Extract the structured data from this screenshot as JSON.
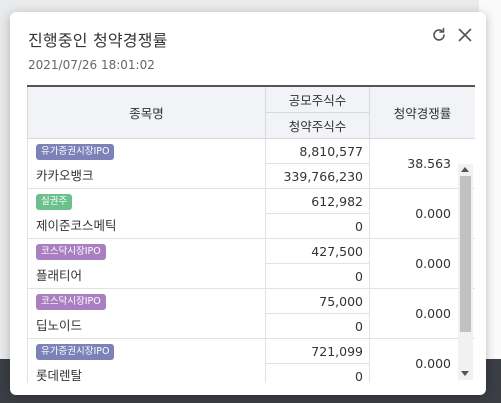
{
  "popup": {
    "title": "진행중인 청약경쟁률",
    "timestamp": "2021/07/26 18:01:02",
    "refresh_icon": "refresh-icon",
    "close_icon": "close-icon"
  },
  "table": {
    "headers": {
      "name": "종목명",
      "offer_shares": "공모주식수",
      "subscribed_shares": "청약주식수",
      "rate": "청약경쟁률"
    },
    "rows": [
      {
        "badge": "유가증권시장IPO",
        "badge_color": "#7b82b8",
        "name": "카카오뱅크",
        "offer": "8,810,577",
        "subscribed": "339,766,230",
        "rate": "38.563"
      },
      {
        "badge": "실권주",
        "badge_color": "#6cc08b",
        "name": "제이준코스메틱",
        "offer": "612,982",
        "subscribed": "0",
        "rate": "0.000"
      },
      {
        "badge": "코스닥시장IPO",
        "badge_color": "#a97fc1",
        "name": "플래티어",
        "offer": "427,500",
        "subscribed": "0",
        "rate": "0.000"
      },
      {
        "badge": "코스닥시장IPO",
        "badge_color": "#a97fc1",
        "name": "딥노이드",
        "offer": "75,000",
        "subscribed": "0",
        "rate": "0.000"
      },
      {
        "badge": "유가증권시장IPO",
        "badge_color": "#7b82b8",
        "name": "롯데렌탈",
        "offer": "721,099",
        "subscribed": "0",
        "rate": "0.000"
      }
    ]
  }
}
